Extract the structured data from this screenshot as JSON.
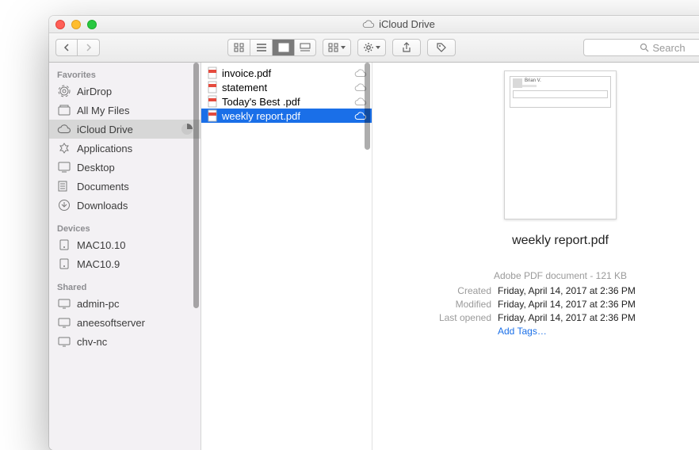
{
  "window": {
    "title": "iCloud Drive"
  },
  "toolbar": {
    "search_placeholder": "Search"
  },
  "sidebar": {
    "groups": [
      {
        "label": "Favorites",
        "items": [
          {
            "icon": "airdrop",
            "label": "AirDrop"
          },
          {
            "icon": "allfiles",
            "label": "All My Files"
          },
          {
            "icon": "cloud",
            "label": "iCloud Drive",
            "selected": true,
            "badge": "pie"
          },
          {
            "icon": "apps",
            "label": "Applications"
          },
          {
            "icon": "desktop",
            "label": "Desktop"
          },
          {
            "icon": "folder",
            "label": "Documents"
          },
          {
            "icon": "downloads",
            "label": "Downloads"
          }
        ]
      },
      {
        "label": "Devices",
        "items": [
          {
            "icon": "drive",
            "label": "MAC10.10"
          },
          {
            "icon": "drive",
            "label": "MAC10.9"
          }
        ]
      },
      {
        "label": "Shared",
        "items": [
          {
            "icon": "monitor",
            "label": "admin-pc"
          },
          {
            "icon": "monitor",
            "label": "aneesoftserver"
          },
          {
            "icon": "monitor",
            "label": "chv-nc"
          }
        ]
      }
    ]
  },
  "files": [
    {
      "name": "invoice.pdf",
      "cloud": true
    },
    {
      "name": "statement",
      "cloud": true
    },
    {
      "name": "Today's Best .pdf",
      "cloud": true
    },
    {
      "name": "weekly report.pdf",
      "cloud": true,
      "selected": true
    }
  ],
  "preview": {
    "thumb_name": "Brian V.",
    "filename": "weekly report.pdf",
    "type_line": "Adobe PDF document - 121 KB",
    "rows": [
      {
        "k": "Created",
        "v": "Friday, April 14, 2017 at 2:36 PM"
      },
      {
        "k": "Modified",
        "v": "Friday, April 14, 2017 at 2:36 PM"
      },
      {
        "k": "Last opened",
        "v": "Friday, April 14, 2017 at 2:36 PM"
      }
    ],
    "add_tags": "Add Tags…"
  }
}
